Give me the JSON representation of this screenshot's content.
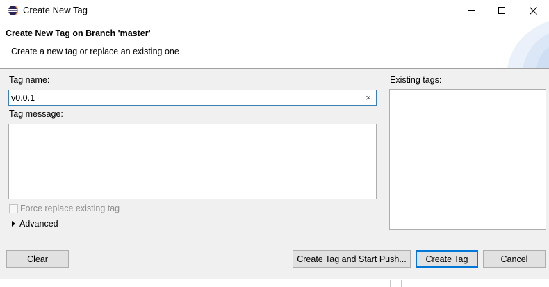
{
  "window": {
    "title": "Create New Tag",
    "minimize_icon": "minimize-icon",
    "maximize_icon": "maximize-icon",
    "close_icon": "close-icon"
  },
  "header": {
    "title": "Create New Tag on Branch 'master'",
    "description": "Create a new tag or replace an existing one"
  },
  "form": {
    "tag_name_label": "Tag name:",
    "tag_name_value": "v0.0.1",
    "tag_message_label": "Tag message:",
    "tag_message_value": "",
    "existing_tags_label": "Existing tags:",
    "existing_tags": [],
    "force_replace_label": "Force replace existing tag",
    "force_replace_checked": false,
    "force_replace_enabled": false,
    "advanced_label": "Advanced"
  },
  "buttons": {
    "clear": "Clear",
    "create_and_push": "Create Tag and Start Push...",
    "create_tag": "Create Tag",
    "cancel": "Cancel"
  },
  "colors": {
    "focus_border": "#3c7fb1",
    "default_button_border": "#0078d7",
    "dialog_background": "#f0f0f0"
  }
}
